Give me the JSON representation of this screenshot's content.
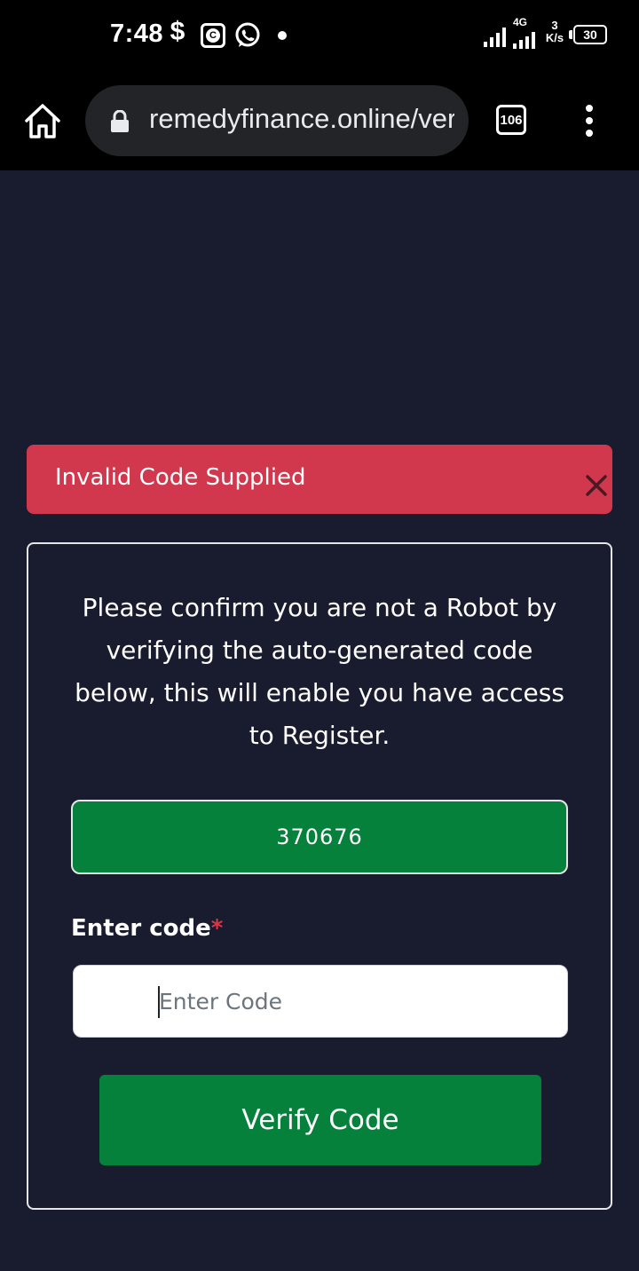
{
  "status_bar": {
    "time": "7:48",
    "network_type": "4G",
    "speed_value": "3",
    "speed_unit": "K/s",
    "battery": "30"
  },
  "browser": {
    "url": "remedyfinance.online/verify",
    "tab_count": "106"
  },
  "alert": {
    "message": "Invalid Code Supplied",
    "color": "#d1384d"
  },
  "verification": {
    "instructions": "Please confirm you are not a Robot by verifying the auto-generated code below, this will enable you have access to Register.",
    "generated_code": "370676",
    "field_label": "Enter code",
    "required_marker": "*",
    "input_placeholder": "Enter Code",
    "input_value": "",
    "submit_label": "Verify Code",
    "accent_color": "#05813c"
  },
  "icons": [
    "dollar-icon",
    "c-app-icon",
    "whatsapp-icon",
    "notification-dot-icon",
    "signal-icon",
    "battery-icon",
    "home-icon",
    "lock-icon",
    "tabs-icon",
    "more-vert-icon",
    "close-icon"
  ]
}
